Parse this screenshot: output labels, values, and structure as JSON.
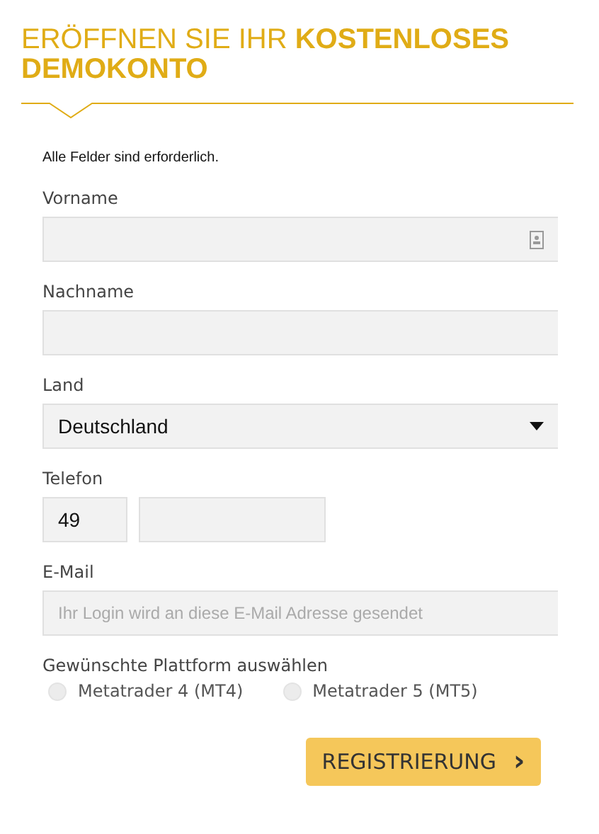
{
  "title": "ERÖFFNEN SIE IHR **KOSTENLOSES DEMOKONTO**",
  "note": "Alle Felder sind erforderlich.",
  "fields": [
    {
      "kind": "text",
      "label": "Vorname",
      "contact_icon": true
    },
    {
      "kind": "text",
      "label": "Nachname"
    },
    {
      "kind": "select",
      "label": "Land",
      "value": "Deutschland"
    },
    {
      "kind": "phone",
      "label": "Telefon",
      "value": "49"
    },
    {
      "kind": "text",
      "label": "E-Mail",
      "placeholder": "Ihr Login wird an diese E-Mail Adresse gesendet"
    }
  ],
  "platform": {
    "label": "Gewünschte Plattform auswählen",
    "options": [
      {
        "label": "Metatrader 4 (MT4)",
        "selected": false
      },
      {
        "label": "Metatrader 5 (MT5)",
        "selected": false
      }
    ]
  },
  "submit": {
    "label": "REGISTRIERUNG",
    "arrow": "›"
  }
}
